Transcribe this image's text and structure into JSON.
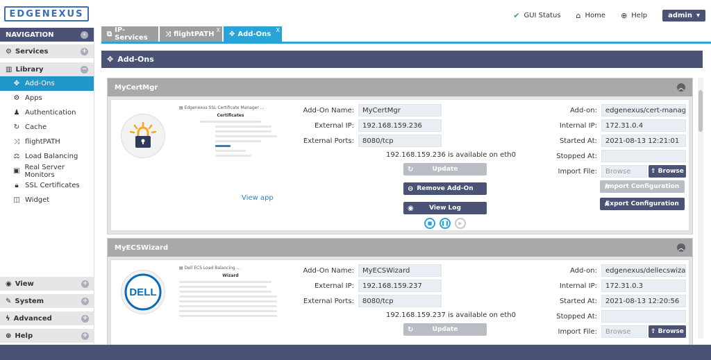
{
  "brand": {
    "logo_text": "EDGENEXUS"
  },
  "topnav": {
    "gui_status": "GUI Status",
    "home": "Home",
    "help": "Help",
    "user": "admin"
  },
  "sidebar": {
    "title": "NAVIGATION",
    "services": "Services",
    "library": "Library",
    "library_items": [
      {
        "label": "Add-Ons",
        "icon": "puzzle-icon"
      },
      {
        "label": "Apps",
        "icon": "gears-icon"
      },
      {
        "label": "Authentication",
        "icon": "user-icon"
      },
      {
        "label": "Cache",
        "icon": "refresh-icon"
      },
      {
        "label": "flightPATH",
        "icon": "shuffle-icon"
      },
      {
        "label": "Load Balancing",
        "icon": "balance-icon"
      },
      {
        "label": "Real Server Monitors",
        "icon": "monitor-icon"
      },
      {
        "label": "SSL Certificates",
        "icon": "lock-icon"
      },
      {
        "label": "Widget",
        "icon": "chart-icon"
      }
    ],
    "view": "View",
    "system": "System",
    "advanced": "Advanced",
    "help": "Help"
  },
  "tabs": [
    {
      "label": "IP-Services",
      "closable": false
    },
    {
      "label": "flightPATH",
      "closable": true,
      "close": "X"
    },
    {
      "label": "Add-Ons",
      "closable": true,
      "close": "X"
    }
  ],
  "page_title": "Add-Ons",
  "labels": {
    "addon_name": "Add-On Name:",
    "external_ip": "External IP:",
    "external_ports": "External Ports:",
    "update": "Update",
    "remove": "Remove Add-On",
    "view_log": "View Log",
    "view_app": "View app",
    "addon": "Add-on:",
    "internal_ip": "Internal IP:",
    "started_at": "Started At:",
    "stopped_at": "Stopped At:",
    "import_file": "Import File:",
    "browse_placeholder": "Browse",
    "browse_btn": "Browse",
    "import_config": "Import Configuration",
    "export_config": "Export Configuration"
  },
  "addons": [
    {
      "title": "MyCertMgr",
      "preview_title": "Edgenexus SSL Certificate Manager ...",
      "preview_heading": "Certificates",
      "name": "MyCertMgr",
      "external_ip": "192.168.159.236",
      "external_ports": "8080/tcp",
      "availability": "192.168.159.236 is available on eth0",
      "image": "edgenexus/cert-manage",
      "internal_ip": "172.31.0.4",
      "started_at": "2021-08-13 12:21:01",
      "stopped_at": ""
    },
    {
      "title": "MyECSWizard",
      "preview_title": "Dell ECS Load Balancing ...",
      "preview_heading": "Wizard",
      "name": "MyECSWizard",
      "external_ip": "192.168.159.237",
      "external_ports": "8080/tcp",
      "availability": "192.168.159.237 is available on eth0",
      "image": "edgenexus/dellecswizarc",
      "internal_ip": "172.31.0.3",
      "started_at": "2021-08-13 12:20:56",
      "stopped_at": ""
    }
  ],
  "dell_logo_text": "DELL"
}
